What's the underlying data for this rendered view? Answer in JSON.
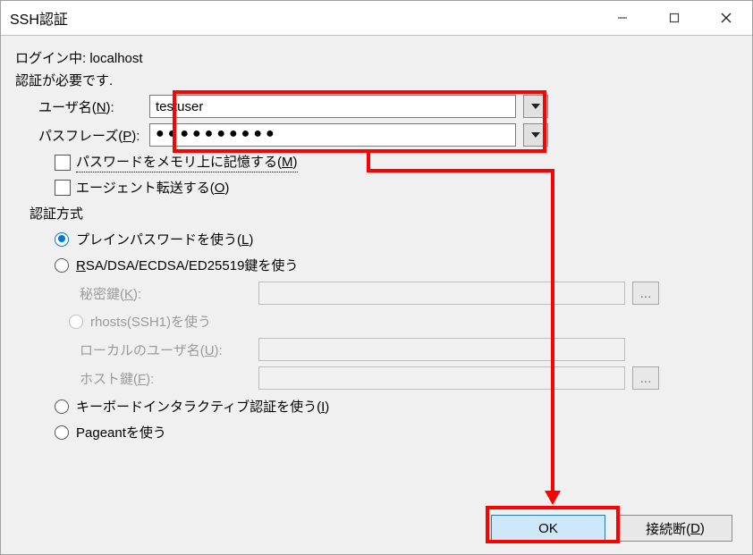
{
  "title": "SSH認証",
  "login_line_prefix": "ログイン中: ",
  "login_host": "localhost",
  "auth_required": "認証が必要です.",
  "username_label_pre": "ユーザ名(",
  "username_label_u": "N",
  "username_label_post": "):",
  "username_value": "testuser",
  "passphrase_label_pre": "パスフレーズ(",
  "passphrase_label_u": "P",
  "passphrase_label_post": "):",
  "passphrase_value": "●●●●●●●●●●",
  "remember_label_pre": "パスワードをメモリ上に記憶する(",
  "remember_label_u": "M",
  "remember_label_post": ")",
  "agent_label_pre": "エージェント転送する(",
  "agent_label_u": "O",
  "agent_label_post": ")",
  "auth_method_header": "認証方式",
  "radio_plain_pre": "プレインパスワードを使う(",
  "radio_plain_u": "L",
  "radio_plain_post": ")",
  "radio_key_pre": "",
  "radio_key_u": "R",
  "radio_key_post": "SA/DSA/ECDSA/ED25519鍵を使う",
  "privkey_label_pre": "秘密鍵(",
  "privkey_label_u": "K",
  "privkey_label_post": "):",
  "radio_rhosts": "rhosts(SSH1)を使う",
  "localuser_label_pre": "ローカルのユーザ名(",
  "localuser_label_u": "U",
  "localuser_label_post": "):",
  "hostkey_label_pre": "ホスト鍵(",
  "hostkey_label_u": "F",
  "hostkey_label_post": "):",
  "radio_kbdint_pre": "キーボードインタラクティブ認証を使う(",
  "radio_kbdint_u": "I",
  "radio_kbdint_post": ")",
  "radio_pageant": "Pageantを使う",
  "browse_btn": "...",
  "ok_btn": "OK",
  "disconnect_btn_pre": "接続断(",
  "disconnect_btn_u": "D",
  "disconnect_btn_post": ")"
}
